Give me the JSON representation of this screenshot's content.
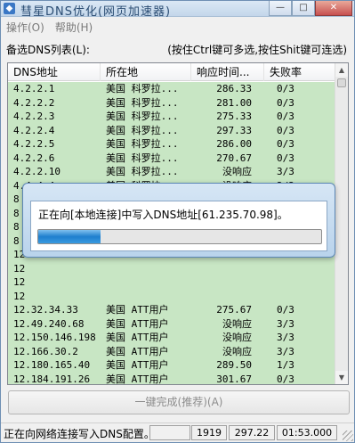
{
  "window": {
    "title": "彗星DNS优化(网页加速器)",
    "minimize_glyph": "—",
    "maximize_glyph": "□",
    "close_glyph": "✕"
  },
  "menu": [
    {
      "label": "操作(O)"
    },
    {
      "label": "帮助(H)"
    }
  ],
  "list": {
    "caption": "备选DNS列表(L):",
    "hint": "(按住Ctrl键可多选,按住Shit键可连选)",
    "columns": [
      "DNS地址",
      "所在地",
      "响应时间...",
      "失败率"
    ],
    "rows": [
      [
        "4.2.2.1",
        "美国 科罗拉...",
        "286.33",
        "0/3"
      ],
      [
        "4.2.2.2",
        "美国 科罗拉...",
        "281.00",
        "0/3"
      ],
      [
        "4.2.2.3",
        "美国 科罗拉...",
        "275.33",
        "0/3"
      ],
      [
        "4.2.2.4",
        "美国 科罗拉...",
        "297.33",
        "0/3"
      ],
      [
        "4.2.2.5",
        "美国 科罗拉...",
        "286.00",
        "0/3"
      ],
      [
        "4.2.2.6",
        "美国 科罗拉...",
        "270.67",
        "0/3"
      ],
      [
        "4.2.2.10",
        "美国 科罗拉...",
        "没响应",
        "3/3"
      ],
      [
        "4.4.4.4",
        "美国 科罗拉...",
        "没响应",
        "3/3"
      ],
      [
        "8",
        "",
        "",
        ""
      ],
      [
        "8",
        "",
        "",
        ""
      ],
      [
        "8",
        "",
        "",
        ""
      ],
      [
        "8",
        "",
        "",
        ""
      ],
      [
        "12",
        "",
        "",
        ""
      ],
      [
        "12",
        "",
        "",
        ""
      ],
      [
        "12",
        "",
        "",
        ""
      ],
      [
        "12",
        "",
        "",
        ""
      ],
      [
        "12.32.34.33",
        "美国 ATT用户",
        "275.67",
        "0/3"
      ],
      [
        "12.49.240.68",
        "美国 ATT用户",
        "没响应",
        "3/3"
      ],
      [
        "12.150.146.198",
        "美国 ATT用户",
        "没响应",
        "3/3"
      ],
      [
        "12.166.30.2",
        "美国 ATT用户",
        "没响应",
        "3/3"
      ],
      [
        "12.180.165.40",
        "美国 ATT用户",
        "289.50",
        "1/3"
      ],
      [
        "12.184.191.26",
        "美国 ATT用户",
        "301.67",
        "0/3"
      ],
      [
        "24.113.0.30",
        "美国",
        "276.00",
        "0/3"
      ],
      [
        "24.113.0.31",
        "美国",
        "292.00",
        "0/3"
      ],
      [
        "24.116.213.232",
        "美国",
        "没响应",
        "3/3"
      ],
      [
        "24.116.219.232",
        "美国",
        "没响应",
        "3/3"
      ]
    ]
  },
  "dialog": {
    "message": "正在向[本地连接]中写入DNS地址[61.235.70.98]。",
    "progress_percent": 22
  },
  "action_button": {
    "label": "一键完成(推荐)(A)"
  },
  "statusbar": {
    "text": "正在向网络连接写入DNS配置。",
    "panes": [
      "",
      "1919",
      "297.22",
      "01:53.000"
    ]
  },
  "colors": {
    "row_background": "#c8e6c4",
    "progress_fill": "#1f7fce"
  }
}
